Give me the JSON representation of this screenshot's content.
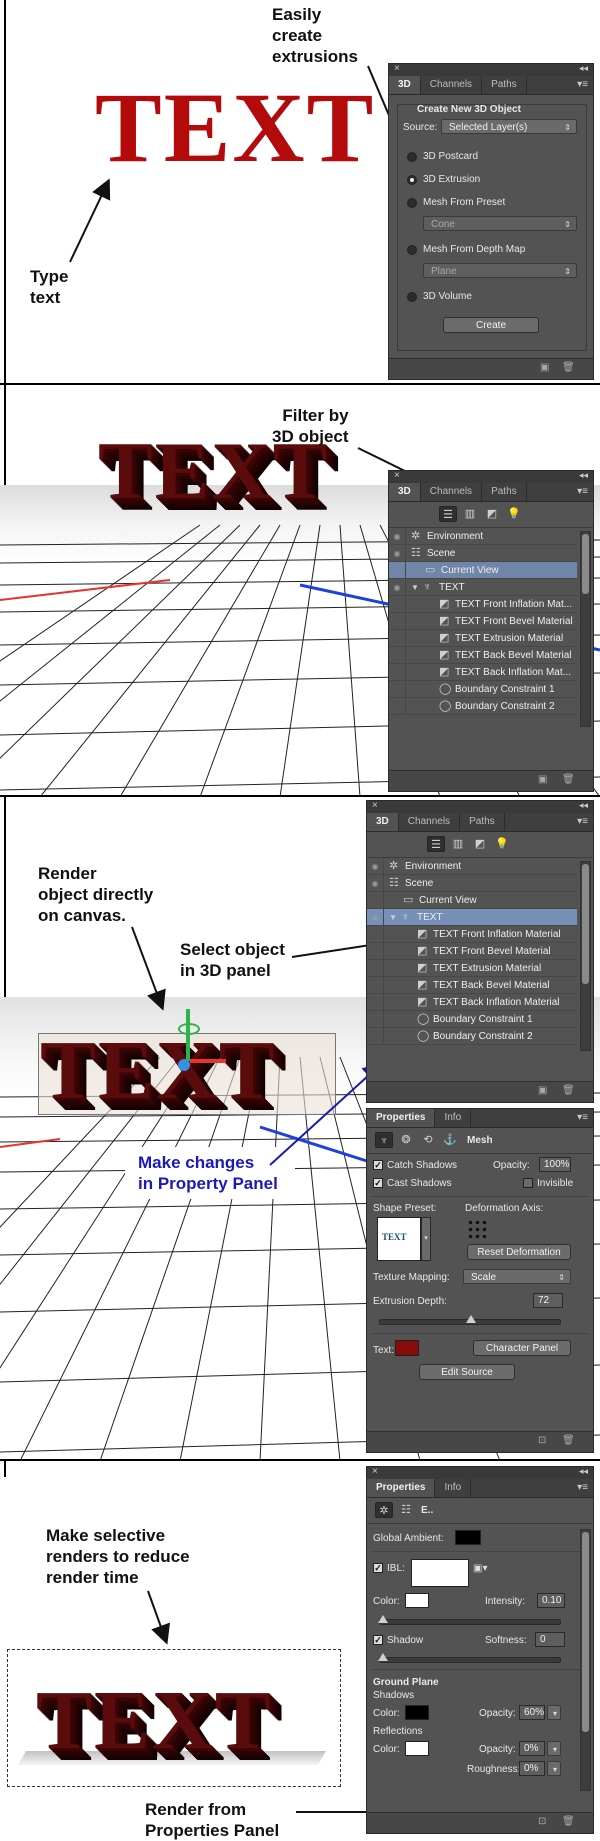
{
  "colors": {
    "accent_red": "#b30b0b",
    "annotation_blue": "#1a1ab8",
    "panel_bg": "#535353"
  },
  "section1": {
    "big_text": "TEXT",
    "note_extrusions": "Easily\ncreate\nextrusions",
    "note_type": "Type\ntext",
    "panel": {
      "tabs": [
        "3D",
        "Channels",
        "Paths"
      ],
      "group_title": "Create New 3D Object",
      "source_label": "Source:",
      "source_value": "Selected Layer(s)",
      "options": [
        "3D Postcard",
        "3D Extrusion",
        "Mesh From Preset",
        "Mesh From Depth Map",
        "3D Volume"
      ],
      "selected_option": "3D Extrusion",
      "preset_value": "Cone",
      "depth_value": "Plane",
      "create_label": "Create"
    }
  },
  "section2": {
    "big_text": "TEXT",
    "note_filter": "Filter by\n3D object",
    "panel": {
      "tabs": [
        "3D",
        "Channels",
        "Paths"
      ],
      "items": [
        "Environment",
        "Scene",
        "Current View",
        "TEXT",
        "TEXT Front Inflation Mat...",
        "TEXT Front Bevel Material",
        "TEXT Extrusion Material",
        "TEXT Back Bevel Material",
        "TEXT Back Inflation Mat...",
        "Boundary Constraint 1",
        "Boundary Constraint 2"
      ]
    }
  },
  "section3": {
    "big_text": "TEXT",
    "note_render": "Render\nobject directly\non canvas.",
    "note_select": "Select object\nin 3D panel",
    "note_changes": "Make changes\nin Property Panel",
    "panel3d": {
      "tabs": [
        "3D",
        "Channels",
        "Paths"
      ],
      "items": [
        "Environment",
        "Scene",
        "Current View",
        "TEXT",
        "TEXT Front Inflation Material",
        "TEXT Front Bevel Material",
        "TEXT Extrusion Material",
        "TEXT Back Bevel Material",
        "TEXT Back Inflation Material",
        "Boundary Constraint 1",
        "Boundary Constraint 2"
      ]
    },
    "props": {
      "tabs": [
        "Properties",
        "Info"
      ],
      "mode_label": "Mesh",
      "catch_shadows": "Catch Shadows",
      "cast_shadows": "Cast Shadows",
      "opacity_label": "Opacity:",
      "opacity_value": "100%",
      "invisible_label": "Invisible",
      "shape_preset_label": "Shape Preset:",
      "preset_thumb_text": "TEXT",
      "deformation_axis_label": "Deformation Axis:",
      "reset_deformation": "Reset Deformation",
      "texture_mapping_label": "Texture Mapping:",
      "texture_mapping_value": "Scale",
      "extrusion_depth_label": "Extrusion Depth:",
      "extrusion_depth_value": "72",
      "text_label": "Text:",
      "character_panel": "Character Panel",
      "edit_source": "Edit Source",
      "text_color": "#8a0b0b"
    }
  },
  "section4": {
    "big_text": "TEXT",
    "note_selective": "Make selective\nrenders to reduce\nrender time",
    "note_render_from": "Render from\nProperties Panel",
    "props": {
      "tabs": [
        "Properties",
        "Info"
      ],
      "mode_label": "E..",
      "global_ambient_label": "Global Ambient:",
      "ibl_label": "IBL:",
      "color_label": "Color:",
      "intensity_label": "Intensity:",
      "intensity_value": "0.10",
      "shadow_label": "Shadow",
      "softness_label": "Softness:",
      "softness_value": "0",
      "ground_plane_label": "Ground Plane",
      "shadows_label": "Shadows",
      "color2_label": "Color:",
      "opacity_label": "Opacity:",
      "opacity_value": "60%",
      "reflections_label": "Reflections",
      "color3_label": "Color:",
      "opacity2_label": "Opacity:",
      "opacity2_value": "0%",
      "roughness_label": "Roughness:",
      "roughness_value": "0%"
    }
  }
}
